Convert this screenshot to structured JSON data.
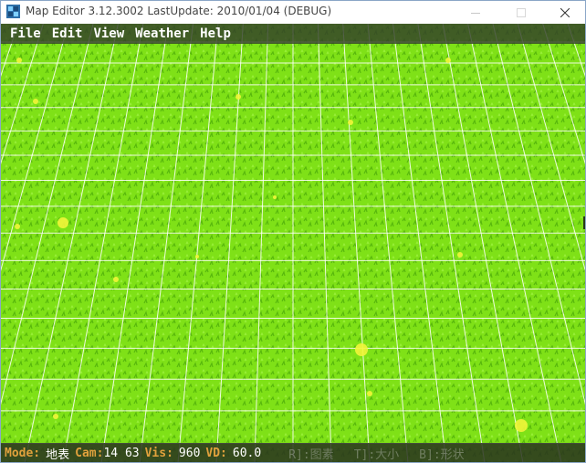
{
  "window": {
    "title": "Map Editor 3.12.3002 LastUpdate: 2010/01/04 (DEBUG)"
  },
  "menu": {
    "items": [
      "File",
      "Edit",
      "View",
      "Weather",
      "Help"
    ]
  },
  "status": {
    "mode_label": "Mode:",
    "mode_value": "地表",
    "cam_label": "Cam:",
    "cam_value": "14 63",
    "vis_label": "Vis:",
    "vis_value": "960",
    "vd_label": "VD:",
    "vd_value": "60.0",
    "hint_r": "R]:图素",
    "hint_t": "T]:大小",
    "hint_b": "B]:形状"
  },
  "colors": {
    "grass": "#7fe117",
    "grid": "#ffffff",
    "flower": "#f2f53a",
    "status_label": "#e0a13c"
  },
  "icons": {
    "app": "map-editor-app-icon",
    "minimize": "minimize-icon",
    "maximize": "maximize-icon",
    "close": "close-icon"
  }
}
